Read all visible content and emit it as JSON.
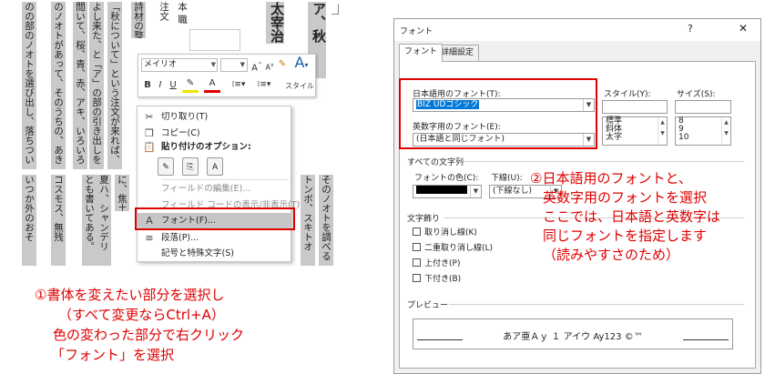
{
  "document": {
    "lines_top": [
      "のの部のノオトを選び出し、落ちつい",
      "のノオトがあって、そのうちの、あき",
      "閲いて、桜、青、赤、アキ、いろいろ",
      "よし来た、と「ア」の部の引き出しを",
      "「秋について」という注文が来れば、",
      "詩材の整理が",
      "注文",
      "本 職",
      "太宰治",
      "ア、秋"
    ],
    "lines_bottom": [
      "いつか外のおそ",
      "コスモス、無残",
      "夏ハ、シャンデリ",
      "とも書いてある。",
      "に、焦土であ",
      "トンボ、スキトオ",
      "そのノオトを調べる"
    ]
  },
  "mini_toolbar": {
    "font_value": "メイリオ",
    "style_label": "スタイル"
  },
  "context_menu": {
    "cut": "切り取り(T)",
    "copy": "コピー(C)",
    "paste_options": "貼り付けのオプション:",
    "edit_field": "フィールドの編集(E)...",
    "toggle_field_codes": "フィールド コードの表示/非表示(T)",
    "font": "フォント(F)...",
    "paragraph": "段落(P)...",
    "symbols": "記号と特殊文字(S)"
  },
  "caption_left": [
    "①書体を変えたい部分を選択し",
    "（すべて変更ならCtrl+A）",
    "色の変わった部分で右クリック",
    "「フォント」を選択"
  ],
  "dialog": {
    "title": "フォント",
    "help": "?",
    "close": "✕",
    "tabs": [
      "フォント",
      "詳細設定"
    ],
    "jp_font_label": "日本語用のフォント(T):",
    "jp_font_value": "BIZ UDゴシック",
    "en_font_label": "英数字用のフォント(E):",
    "en_font_value": "(日本語と同じフォント)",
    "style_label": "スタイル(Y):",
    "style_options": [
      "標準",
      "斜体",
      "太字"
    ],
    "size_label": "サイズ(S):",
    "size_options": [
      "8",
      "9",
      "10"
    ],
    "all_text": "すべての文字列",
    "font_color_label": "フォントの色(C):",
    "underline_label": "下線(U):",
    "underline_value": "(下線なし)",
    "effects_label": "文字飾り",
    "effects": [
      "取り消し線(K)",
      "二重取り消し線(L)",
      "上付き(P)",
      "下付き(B)"
    ],
    "preview_label": "プレビュー",
    "preview_text": "あア亜Ａｙ １ アイウ Ay123 ©™"
  },
  "caption_right": [
    "②日本語用のフォントと、",
    "英数字用のフォントを選択",
    "ここでは、日本語と英数字は",
    "同じフォントを指定します",
    "（読みやすさのため）"
  ],
  "colors": {
    "annotation_red": "#e00000",
    "selection_gray": "#c9c9c9",
    "highlight_blue": "#0078d7"
  }
}
